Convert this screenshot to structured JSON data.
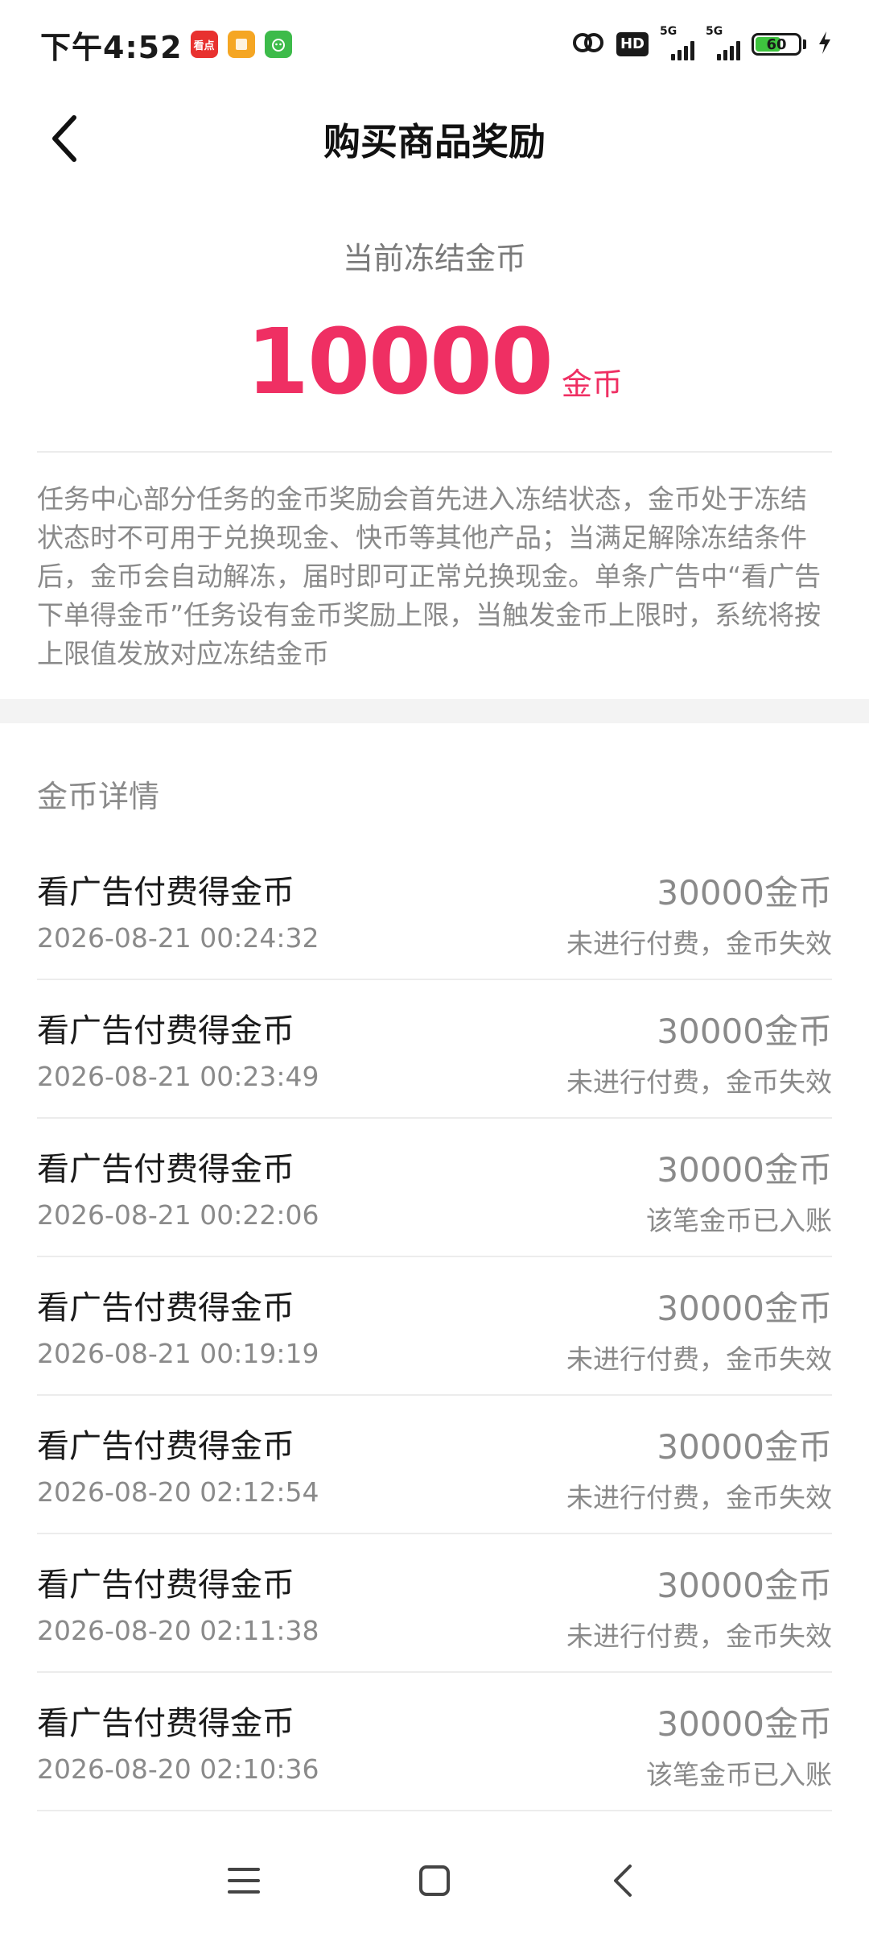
{
  "status_bar": {
    "time": "下午4:52",
    "app_icons": [
      {
        "name": "kandian-app-icon",
        "label": "看点",
        "color": "#e8312f"
      },
      {
        "name": "notes-app-icon",
        "label": "",
        "color": "#f5a623"
      },
      {
        "name": "green-app-icon",
        "label": "",
        "color": "#3dbb4a"
      }
    ],
    "hd_label": "HD",
    "signal_1_label": "5G",
    "signal_2_label": "5G",
    "battery_level": "60"
  },
  "header": {
    "title": "购买商品奖励"
  },
  "frozen": {
    "label": "当前冻结金币",
    "amount": "10000",
    "unit": "金币"
  },
  "description": "任务中心部分任务的金币奖励会首先进入冻结状态，金币处于冻结状态时不可用于兑换现金、快币等其他产品；当满足解除冻结条件后，金币会自动解冻，届时即可正常兑换现金。单条广告中“看广告下单得金币”任务设有金币奖励上限，当触发金币上限时，系统将按上限值发放对应冻结金币",
  "records": {
    "header": "金币详情",
    "items": [
      {
        "title": "看广告付费得金币",
        "time": "2026-08-21 00:24:32",
        "amount": "30000金币",
        "status": "未进行付费，金币失效"
      },
      {
        "title": "看广告付费得金币",
        "time": "2026-08-21 00:23:49",
        "amount": "30000金币",
        "status": "未进行付费，金币失效"
      },
      {
        "title": "看广告付费得金币",
        "time": "2026-08-21 00:22:06",
        "amount": "30000金币",
        "status": "该笔金币已入账"
      },
      {
        "title": "看广告付费得金币",
        "time": "2026-08-21 00:19:19",
        "amount": "30000金币",
        "status": "未进行付费，金币失效"
      },
      {
        "title": "看广告付费得金币",
        "time": "2026-08-20 02:12:54",
        "amount": "30000金币",
        "status": "未进行付费，金币失效"
      },
      {
        "title": "看广告付费得金币",
        "time": "2026-08-20 02:11:38",
        "amount": "30000金币",
        "status": "未进行付费，金币失效"
      },
      {
        "title": "看广告付费得金币",
        "time": "2026-08-20 02:10:36",
        "amount": "30000金币",
        "status": "该笔金币已入账"
      }
    ]
  },
  "colors": {
    "accent": "#ef2f63",
    "muted_text": "#8a8a8a",
    "divider": "#ececec"
  }
}
